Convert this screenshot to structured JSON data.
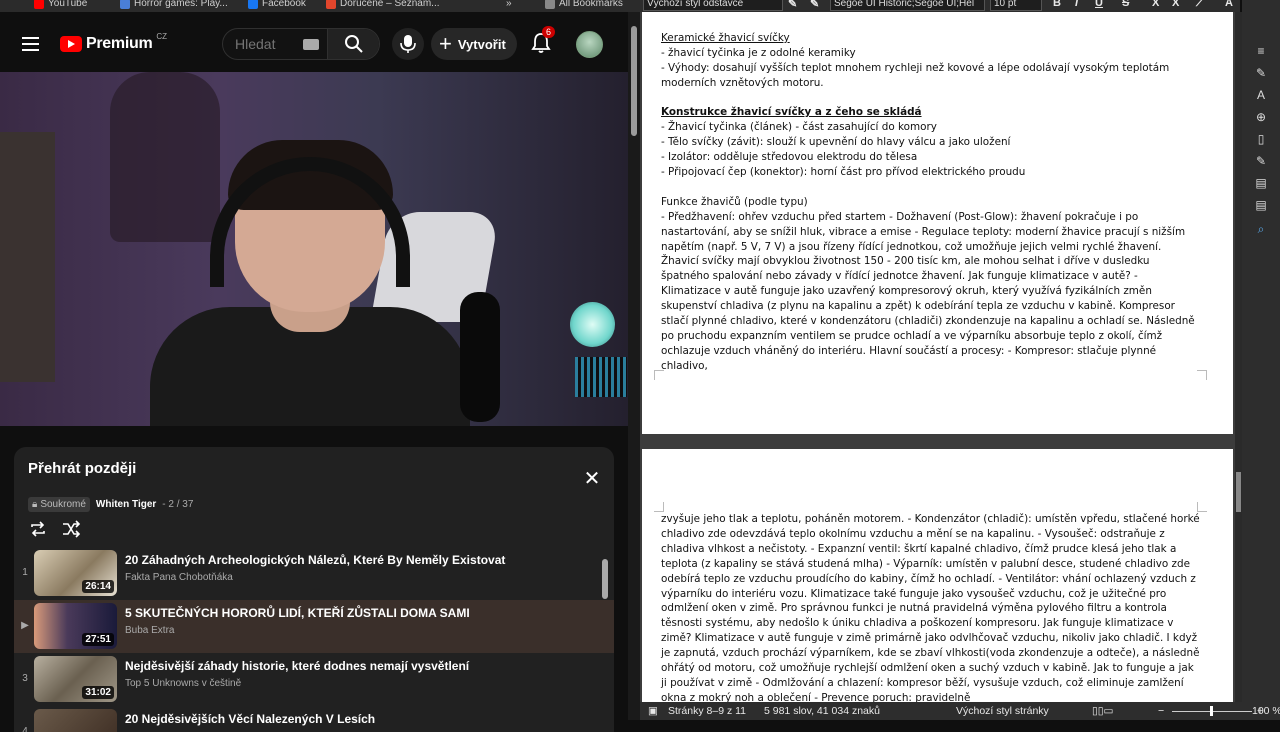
{
  "bookmarks": [
    {
      "label": "YouTube",
      "color": "#ff0000"
    },
    {
      "label": "Horror games: Play...",
      "color": "#4a7fd8"
    },
    {
      "label": "Facebook",
      "color": "#1877f2"
    },
    {
      "label": "Doručené – Seznam...",
      "color": "#e2462c"
    },
    {
      "label": "»",
      "color": ""
    },
    {
      "label": "All Bookmarks",
      "color": "#888888"
    }
  ],
  "youtube": {
    "logo": "Premium",
    "logo_region": "CZ",
    "search_placeholder": "Hledat",
    "create_label": "Vytvořit",
    "notifications_count": "6"
  },
  "playlist": {
    "title": "Přehrát později",
    "privacy": "Soukromé",
    "owner": "Whiten Tiger",
    "position": "- 2 / 37",
    "items": [
      {
        "index": "1",
        "title": "20 Záhadných Archeologických Nálezů, Které By Neměly Existovat",
        "channel": "Fakta Pana Chobotňáka",
        "duration": "26:14",
        "thumb": "linear-gradient(135deg,#d9cdb4,#8a7a60 55%,#e8e2d4)"
      },
      {
        "index": "▶",
        "title": "5 SKUTEČNÝCH HORORŮ LIDÍ, KTEŘÍ ZŮSTALI DOMA SAMI",
        "channel": "Buba Extra",
        "duration": "27:51",
        "thumb": "linear-gradient(90deg,#d89a7a,#4a3a5a 40%,#1a1a3a)"
      },
      {
        "index": "3",
        "title": "Nejděsivější záhady historie, které dodnes nemají vysvětlení",
        "channel": "Top 5 Unknowns v češtině",
        "duration": "31:02",
        "thumb": "linear-gradient(135deg,#b8b0a0,#6a6050 50%,#a09888)"
      },
      {
        "index": "4",
        "title": "20 Nejděsivějších Věcí Nalezených V Lesích",
        "channel": "",
        "duration": "",
        "thumb": "linear-gradient(135deg,#6a5a4a,#3a2a20)"
      }
    ]
  },
  "writer": {
    "paragraph_style": "Výchozí styl odstavce",
    "font_name": "Segoe UI Historic;Segoe UI;Hel",
    "font_size": "10 pt",
    "page1": [
      {
        "type": "gap"
      },
      {
        "type": "u",
        "text": "Keramické žhavicí svíčky"
      },
      {
        "type": "p",
        "text": "- žhavicí tyčinka je z odolné keramiky"
      },
      {
        "type": "p",
        "text": "- Výhody: dosahují vyšších teplot mnohem rychleji než kovové a lépe odolávají vysokým teplotám moderních vznětových motoru."
      },
      {
        "type": "gap"
      },
      {
        "type": "bu",
        "text": "Konstrukce žhavicí svíčky a z čeho se skládá"
      },
      {
        "type": "p",
        "text": "- Žhavicí tyčinka (článek) - část zasahující do komory"
      },
      {
        "type": "p",
        "text": "- Tělo svíčky (závit): slouží k upevnění do hlavy válcu a jako uložení"
      },
      {
        "type": "p",
        "text": "- Izolátor: odděluje středovou elektrodu do tělesa"
      },
      {
        "type": "p",
        "text": "- Připojovací čep (konektor): horní část pro přívod elektrického proudu"
      },
      {
        "type": "gap"
      },
      {
        "type": "p",
        "text": "Funkce žhavičů (podle typu)"
      },
      {
        "type": "p",
        "text": "- Předžhavení: ohřev vzduchu před startem - Dožhavení (Post-Glow): žhavení pokračuje i po nastartování, aby se snížil hluk, vibrace a emise - Regulace teploty: moderní žhavice pracují s nižším napětím (např. 5 V, 7 V) a jsou řízeny řídící jednotkou, což umožňuje jejich velmi rychlé žhavení. Žhavicí svíčky mají obvyklou životnost 150 - 200 tisíc km, ale mohou selhat i dříve v dusledku špatného spalování nebo závady v řídící jednotce žhavení. Jak funguje klimatizace v autě? - Klimatizace v autě funguje jako uzavřený kompresorový okruh, který využívá fyzikálních změn skupenství chladiva (z plynu na kapalinu a zpět) k odebírání tepla ze vzduchu v kabině. Kompresor stlačí plynné chladivo, které v kondenzátoru (chladiči) zkondenzuje na kapalinu a ochladí se. Následně po pruchodu expanzním ventilem se prudce ochladí a ve výparníku absorbuje teplo z okolí, čímž ochlazuje vzduch vháněný do interiéru. Hlavní součástí a procesy: - Kompresor: stlačuje plynné chladivo,"
      }
    ],
    "page2": [
      {
        "type": "p",
        "text": "zvyšuje jeho tlak a teplotu, poháněn motorem. - Kondenzátor (chladič): umístěn vpředu, stlačené horké chladivo zde odevzdává teplo okolnímu vzduchu a mění se na kapalinu. - Vysoušeč: odstraňuje z chladiva vlhkost a nečistoty. - Expanzní ventil: škrtí kapalné chladivo, čímž prudce klesá jeho tlak a teplota (z kapaliny se stává studená mlha) - Výparník: umístěn v palubní desce, studené chladivo zde odebírá teplo ze vzduchu proudícího do kabiny, čímž ho ochladí. - Ventilátor: vhání ochlazený vzduch z výparníku do interiéru vozu. Klimatizace také funguje jako vysoušeč vzduchu, což je užitečné pro odmlžení oken v zimě. Pro správnou funkci je nutná pravidelná výměna pylového filtru a kontrola těsnosti systému, aby nedošlo k úniku chladiva a poškození kompresoru. Jak funguje klimatizace v zimě? Klimatizace v autě funguje v zimě primárně jako odvlhčovač vzduchu, nikoliv jako chladič. I když je zapnutá, vzduch prochází výparníkem, kde se zbaví vlhkosti(voda zkondenzuje a odteče), a následně ohřátý od motoru, což umožňuje rychlejší odmlžení oken a suchý vzduch v kabině. Jak to funguje a jak ji používat v zimě - Odmlžování a chlazení: kompresor běží, vysušuje vzduch, což eliminuje zamlžení okna z mokrý noh a oblečení - Prevence poruch: pravidelně"
      }
    ],
    "status": {
      "pages": "Stránky 8–9 z 11",
      "words": "5 981 slov, 41 034 znaků",
      "style": "Výchozí styl stránky",
      "zoom": "100 %"
    }
  }
}
